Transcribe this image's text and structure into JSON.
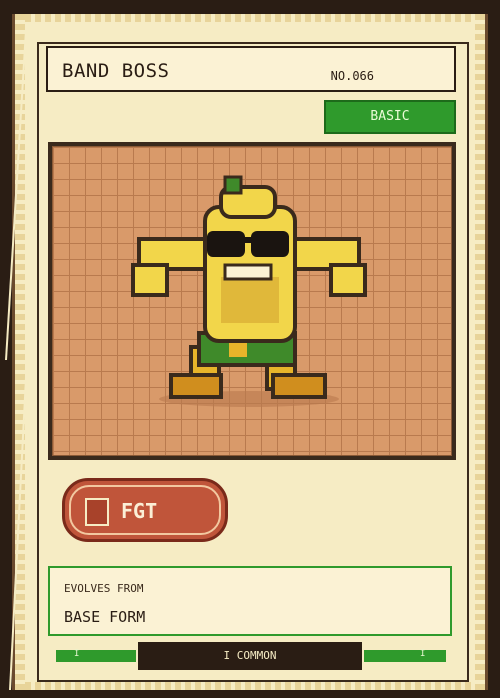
{
  "card": {
    "name": "BAND BOSS",
    "number": "NO.066",
    "stage": "BASIC",
    "type": "FGT",
    "evolves_from_label": "EVOLVES FROM",
    "evolves_from_value": "BASE FORM",
    "rarity": "I COMMON",
    "strip_left": "I",
    "strip_right": "I"
  },
  "colors": {
    "card_cream": "#f6ecc4",
    "frame_dark": "#2a1d14",
    "stage_green": "#2f9a2c",
    "type_red": "#c0553a",
    "art_bg": "#d99a6a"
  },
  "art": {
    "subject_icon": "banana-character-sunglasses"
  }
}
